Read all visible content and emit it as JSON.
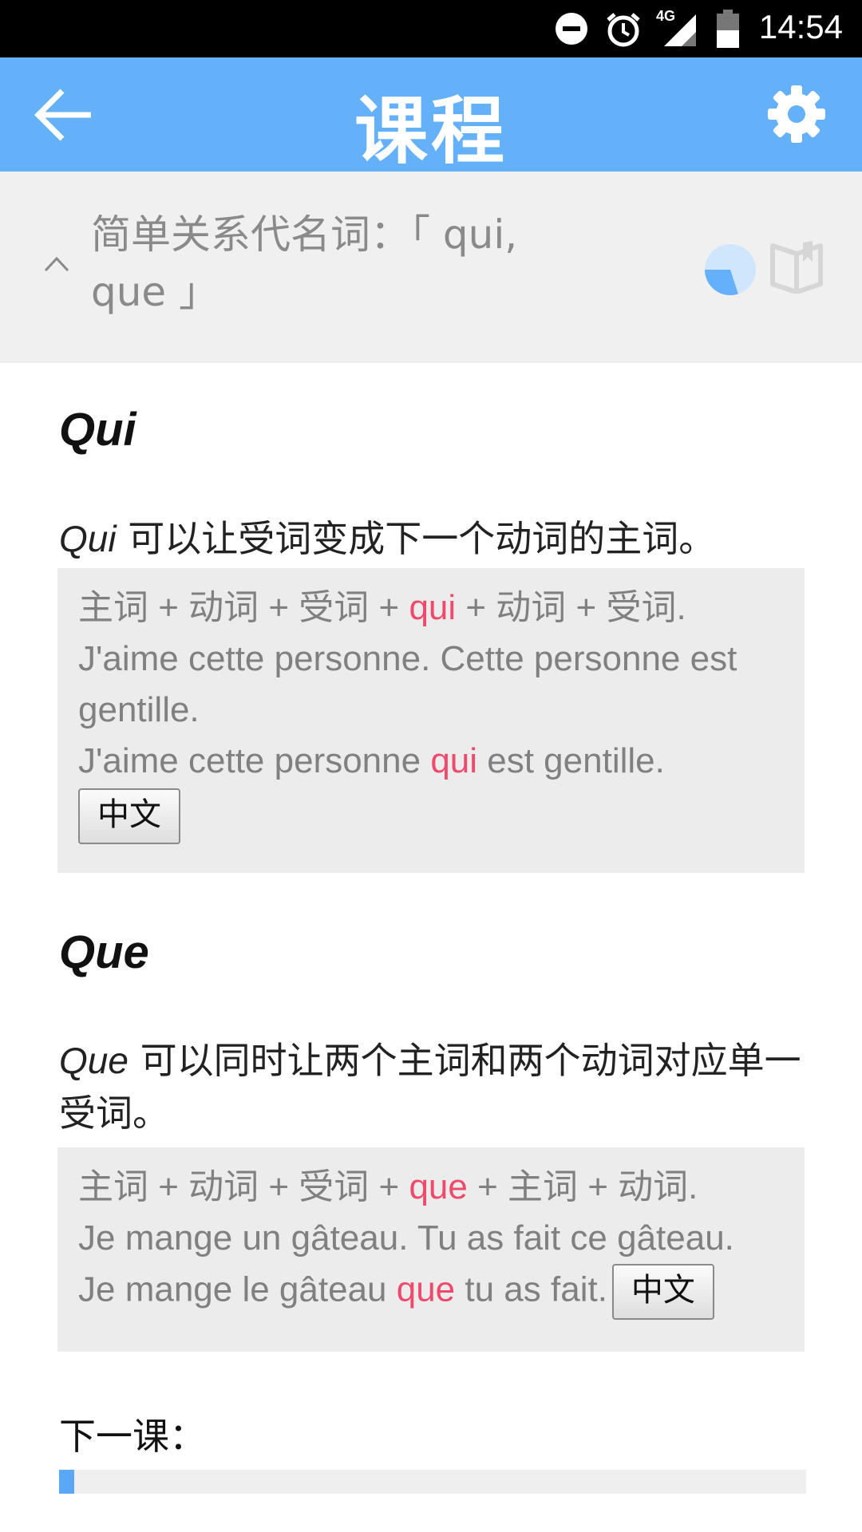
{
  "status_bar": {
    "time": "14:54",
    "network": "4G",
    "icons": [
      "do-not-disturb-icon",
      "alarm-icon",
      "signal-icon",
      "battery-icon"
    ]
  },
  "app_bar": {
    "title": "课程",
    "back_icon": "arrow-back-icon",
    "settings_icon": "gear-icon",
    "color": "#64b1fa"
  },
  "lesson": {
    "title": "简单关系代名词：「 qui, que 」",
    "progress_fraction": 0.3,
    "progress_color": "#64b1fa",
    "progress_bg": "#cfe6fd"
  },
  "sections": [
    {
      "heading": "Qui",
      "intro_keyword": "Qui",
      "intro_text": " 可以让受词变成下一个动词的主词。",
      "formula_pre": "主词 + 动词 + 受词 + ",
      "formula_key": "qui",
      "formula_post": " + 动词 + 受词.",
      "example_1": "J'aime cette personne. Cette personne est gentille.",
      "example_2_pre": "J'aime cette personne ",
      "example_2_key": "qui",
      "example_2_post": " est gentille.",
      "button": "中文"
    },
    {
      "heading": "Que",
      "intro_keyword": "Que",
      "intro_text": " 可以同时让两个主词和两个动词对应单一受词。",
      "formula_pre": "主词 + 动词 + 受词 + ",
      "formula_key": "que",
      "formula_post": " + 主词 + 动词.",
      "example_1": "Je mange un gâteau. Tu as fait ce gâteau.",
      "example_2_pre": "Je mange le gâteau ",
      "example_2_key": "que",
      "example_2_post": " tu as fait.",
      "button": "中文"
    }
  ],
  "next_lesson": {
    "label": "下一课：",
    "progress_fraction": 0.02
  },
  "colors": {
    "highlight": "#ee4a6c",
    "example_bg": "#ececec"
  }
}
